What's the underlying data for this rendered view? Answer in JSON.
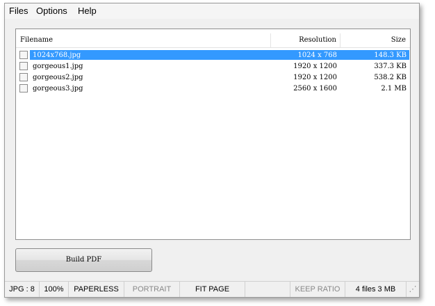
{
  "menubar": {
    "files": "Files",
    "options": "Options",
    "help": "Help"
  },
  "list": {
    "columns": {
      "filename": "Filename",
      "resolution": "Resolution",
      "size": "Size"
    },
    "rows": [
      {
        "filename": "1024x768.jpg",
        "resolution": "1024 x 768",
        "size": "148.3 KB",
        "selected": true
      },
      {
        "filename": "gorgeous1.jpg",
        "resolution": "1920 x 1200",
        "size": "337.3 KB",
        "selected": false
      },
      {
        "filename": "gorgeous2.jpg",
        "resolution": "1920 x 1200",
        "size": "538.2 KB",
        "selected": false
      },
      {
        "filename": "gorgeous3.jpg",
        "resolution": "2560 x 1600",
        "size": "2.1 MB",
        "selected": false
      }
    ]
  },
  "build_button": {
    "label": "Build PDF"
  },
  "statusbar": {
    "format": "JPG : 8",
    "zoom": "100%",
    "paperless": "PAPERLESS",
    "portrait": "PORTRAIT",
    "fit_page": "FIT PAGE",
    "keep_ratio": "KEEP RATIO",
    "files_count": "4 files 3 MB"
  },
  "colors": {
    "selection": "#3399ff",
    "disabled_text": "#888888"
  }
}
